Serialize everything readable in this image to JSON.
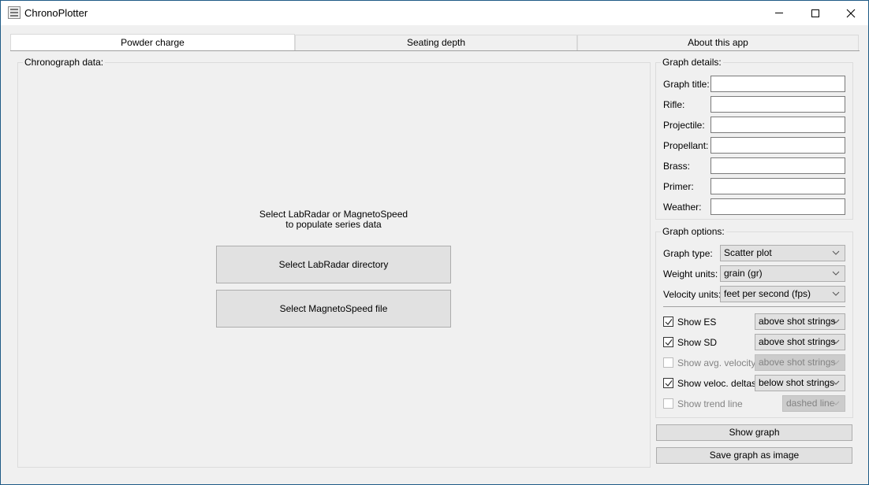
{
  "window": {
    "title": "ChronoPlotter",
    "icon": "app-icon",
    "controls": {
      "minimize": "minimize-icon",
      "maximize": "maximize-icon",
      "close": "close-icon"
    }
  },
  "tabs": [
    {
      "label": "Powder charge",
      "active": true
    },
    {
      "label": "Seating depth",
      "active": false
    },
    {
      "label": "About this app",
      "active": false
    }
  ],
  "chronograph": {
    "group_title": "Chronograph data:",
    "hint_line1": "Select LabRadar or MagnetoSpeed",
    "hint_line2": "to populate series data",
    "labradar_button": "Select LabRadar directory",
    "magnetospeed_button": "Select MagnetoSpeed file"
  },
  "graph_details": {
    "group_title": "Graph details:",
    "fields": [
      {
        "label": "Graph title:",
        "value": ""
      },
      {
        "label": "Rifle:",
        "value": ""
      },
      {
        "label": "Projectile:",
        "value": ""
      },
      {
        "label": "Propellant:",
        "value": ""
      },
      {
        "label": "Brass:",
        "value": ""
      },
      {
        "label": "Primer:",
        "value": ""
      },
      {
        "label": "Weather:",
        "value": ""
      }
    ]
  },
  "graph_options": {
    "group_title": "Graph options:",
    "graph_type": {
      "label": "Graph type:",
      "value": "Scatter plot"
    },
    "weight_units": {
      "label": "Weight units:",
      "value": "grain (gr)"
    },
    "velocity_units": {
      "label": "Velocity units:",
      "value": "feet per second (fps)"
    },
    "toggles": [
      {
        "label": "Show ES",
        "checked": true,
        "enabled": true,
        "position": "above shot strings"
      },
      {
        "label": "Show SD",
        "checked": true,
        "enabled": true,
        "position": "above shot strings"
      },
      {
        "label": "Show avg. velocity",
        "checked": false,
        "enabled": false,
        "position": "above shot strings"
      },
      {
        "label": "Show veloc. deltas",
        "checked": true,
        "enabled": true,
        "position": "below shot strings"
      },
      {
        "label": "Show trend line",
        "checked": false,
        "enabled": false,
        "position": "dashed line"
      }
    ]
  },
  "actions": {
    "show_graph": "Show graph",
    "save_graph": "Save graph as image"
  }
}
